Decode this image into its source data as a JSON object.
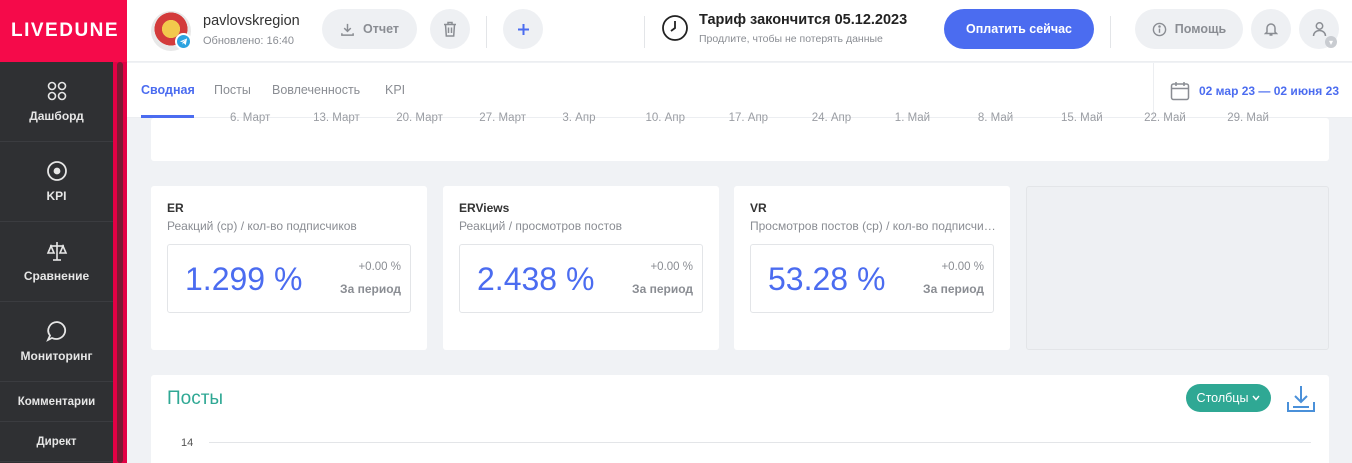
{
  "brand": {
    "logo_text": "LIVEDUNE"
  },
  "sidebar": {
    "items": [
      {
        "label": "Дашборд",
        "icon": "dashboard-icon"
      },
      {
        "label": "KPI",
        "icon": "target-icon"
      },
      {
        "label": "Сравнение",
        "icon": "scales-icon"
      },
      {
        "label": "Мониторинг",
        "icon": "chat-bubble-icon"
      }
    ],
    "subitems": [
      {
        "label": "Комментарии"
      },
      {
        "label": "Директ"
      }
    ]
  },
  "header": {
    "account_name": "pavlovskregion",
    "updated": "Обновлено: 16:40",
    "report_label": "Отчет",
    "tariff_title": "Тариф закончится 05.12.2023",
    "tariff_subtitle": "Продлите, чтобы не потерять данные",
    "pay_label": "Оплатить сейчас",
    "help_label": "Помощь"
  },
  "tabs": [
    {
      "label": "Сводная",
      "active": true
    },
    {
      "label": "Посты",
      "active": false
    },
    {
      "label": "Вовлеченность",
      "active": false
    },
    {
      "label": "KPI",
      "active": false
    }
  ],
  "date_range": "02 мар 23 — 02 июня 23",
  "timeline_ticks": [
    "6. Март",
    "13. Март",
    "20. Март",
    "27. Март",
    "3. Апр",
    "10. Апр",
    "17. Апр",
    "24. Апр",
    "1. Май",
    "8. Май",
    "15. Май",
    "22. Май",
    "29. Май"
  ],
  "metrics": [
    {
      "title": "ER",
      "subtitle": "Реакций (ср) / кол-во подписчиков",
      "value": "1.299 %",
      "delta": "+0.00 %",
      "period": "За период"
    },
    {
      "title": "ERViews",
      "subtitle": "Реакций / просмотров постов",
      "value": "2.438 %",
      "delta": "+0.00 %",
      "period": "За период"
    },
    {
      "title": "VR",
      "subtitle": "Просмотров постов (ср) / кол-во подписчиков",
      "value": "53.28 %",
      "delta": "+0.00 %",
      "period": "За период"
    }
  ],
  "posts": {
    "title": "Посты",
    "columns_label": "Столбцы",
    "y_tick": "14"
  },
  "colors": {
    "brand": "#f50a4a",
    "accent": "#4b6cf0",
    "teal": "#2fa894",
    "sidebar": "#2f3033"
  }
}
